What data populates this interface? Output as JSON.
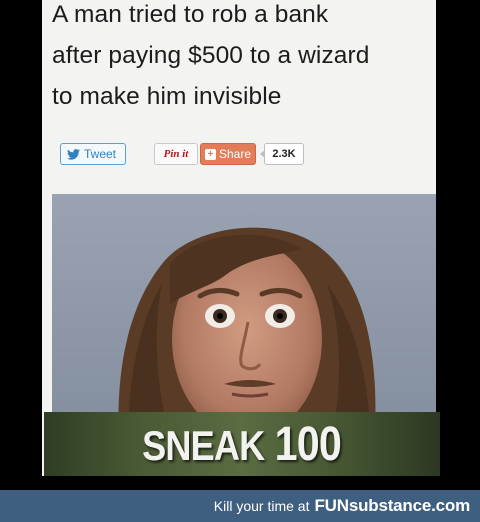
{
  "headline": {
    "line1": "A man tried to rob a bank",
    "line2": "after paying $500 to a wizard",
    "line3": "to make him invisible"
  },
  "share": {
    "tweet_label": "Tweet",
    "pin_label": "Pin it",
    "share_label": "Share",
    "share_count": "2.3K"
  },
  "overlay": {
    "word": "SNEAK",
    "number": "100"
  },
  "footer": {
    "tagline": "Kill your time at",
    "brand_caps": "FUN",
    "brand_rest": "substance.com"
  },
  "colors": {
    "tweet": "#2f82c2",
    "share": "#e37d59",
    "footer": "#3f5f80",
    "overlay": "#4a5b35"
  }
}
